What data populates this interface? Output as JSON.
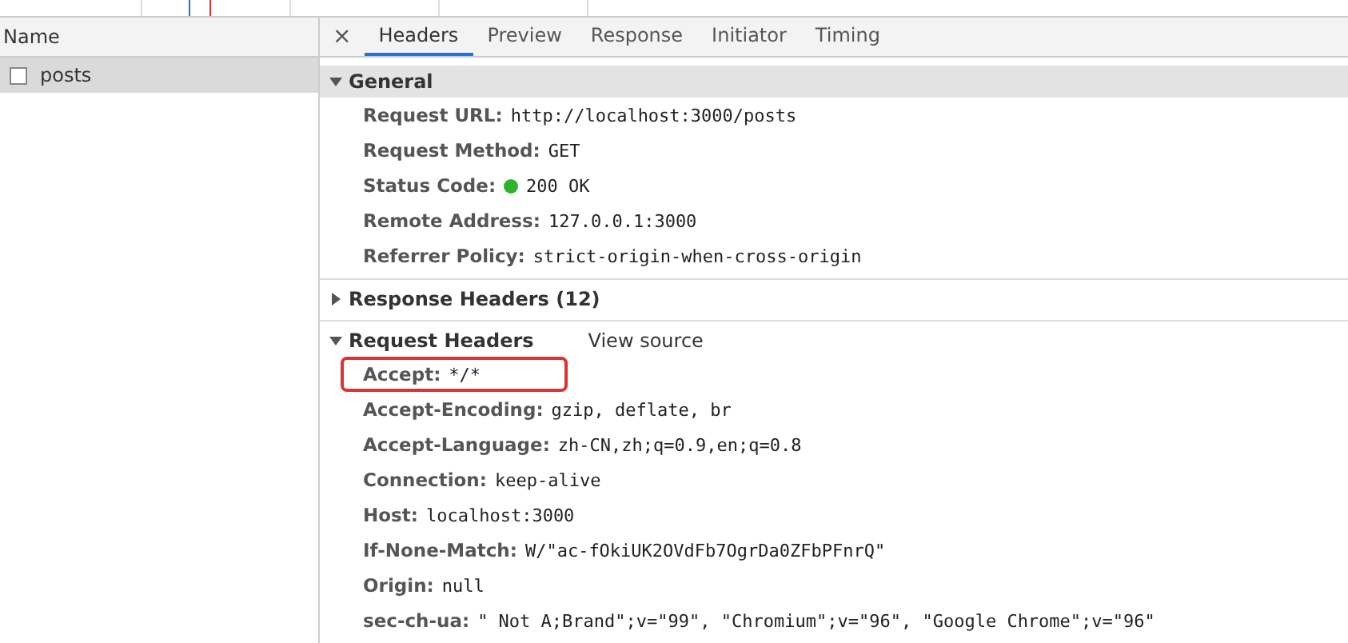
{
  "requests": {
    "column_header": "Name",
    "rows": [
      {
        "name": "posts",
        "selected": true,
        "checked": false
      }
    ]
  },
  "detail": {
    "close": "×",
    "tabs": [
      {
        "label": "Headers",
        "selected": true
      },
      {
        "label": "Preview",
        "selected": false
      },
      {
        "label": "Response",
        "selected": false
      },
      {
        "label": "Initiator",
        "selected": false
      },
      {
        "label": "Timing",
        "selected": false
      }
    ],
    "sections": [
      {
        "title": "General",
        "expanded": true,
        "shaded": true,
        "rows": [
          {
            "name": "Request URL:",
            "value": "http://localhost:3000/posts",
            "highlighted": false
          },
          {
            "name": "Request Method:",
            "value": "GET",
            "highlighted": false
          },
          {
            "name": "Status Code:",
            "value": "200 OK",
            "color": "#2ab52a",
            "highlighted": false
          },
          {
            "name": "Remote Address:",
            "value": "127.0.0.1:3000",
            "highlighted": false
          },
          {
            "name": "Referrer Policy:",
            "value": "strict-origin-when-cross-origin",
            "highlighted": false
          }
        ]
      },
      {
        "title": "Response Headers (12)",
        "expanded": false,
        "shaded": false
      },
      {
        "title": "Request Headers",
        "expanded": true,
        "shaded": false,
        "link": "View source",
        "rows": [
          {
            "name": "Accept:",
            "value": "*/*",
            "highlighted": true
          },
          {
            "name": "Accept-Encoding:",
            "value": "gzip, deflate, br",
            "highlighted": false
          },
          {
            "name": "Accept-Language:",
            "value": "zh-CN,zh;q=0.9,en;q=0.8",
            "highlighted": false
          },
          {
            "name": "Connection:",
            "value": "keep-alive",
            "highlighted": false
          },
          {
            "name": "Host:",
            "value": "localhost:3000",
            "highlighted": false
          },
          {
            "name": "If-None-Match:",
            "value": "W/\"ac-fOkiUK2OVdFb7OgrDa0ZFbPFnrQ\"",
            "highlighted": false
          },
          {
            "name": "Origin:",
            "value": "null",
            "highlighted": false
          },
          {
            "name": "sec-ch-ua:",
            "value": "\" Not A;Brand\";v=\"99\", \"Chromium\";v=\"96\", \"Google Chrome\";v=\"96\"",
            "highlighted": false
          }
        ]
      }
    ]
  }
}
